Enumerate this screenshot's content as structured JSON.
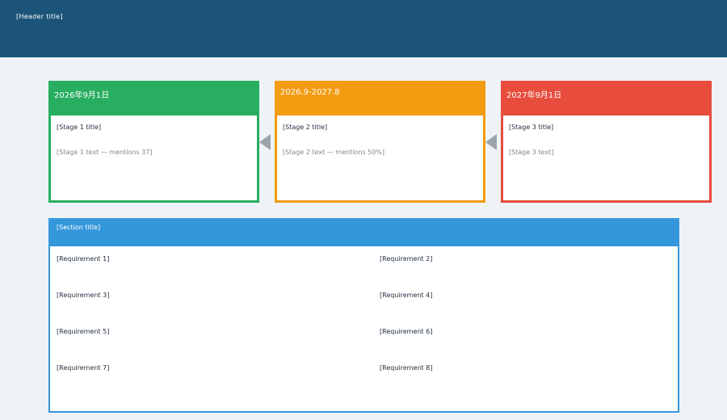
{
  "header": {
    "title": "[Header title]"
  },
  "stages": [
    {
      "date": "2026年9月1日",
      "title": "[Stage 1 title]",
      "desc": "[Stage 1 text — mentions 37]",
      "color": "#27ae60"
    },
    {
      "date": "2026.9-2027.8",
      "title": "[Stage 2 title]",
      "desc": "[Stage 2 text — mentions 50%]",
      "color": "#f39c12"
    },
    {
      "date": "2027年9月1日",
      "title": "[Stage 3 title]",
      "desc": "[Stage 3 text]",
      "color": "#e74c3c"
    }
  ],
  "requirements": {
    "title": "[Section title]",
    "color": "#3597db",
    "items": [
      "[Requirement 1]",
      "[Requirement 2]",
      "[Requirement 3]",
      "[Requirement 4]",
      "[Requirement 5]",
      "[Requirement 6]",
      "[Requirement 7]",
      "[Requirement 8]"
    ]
  }
}
